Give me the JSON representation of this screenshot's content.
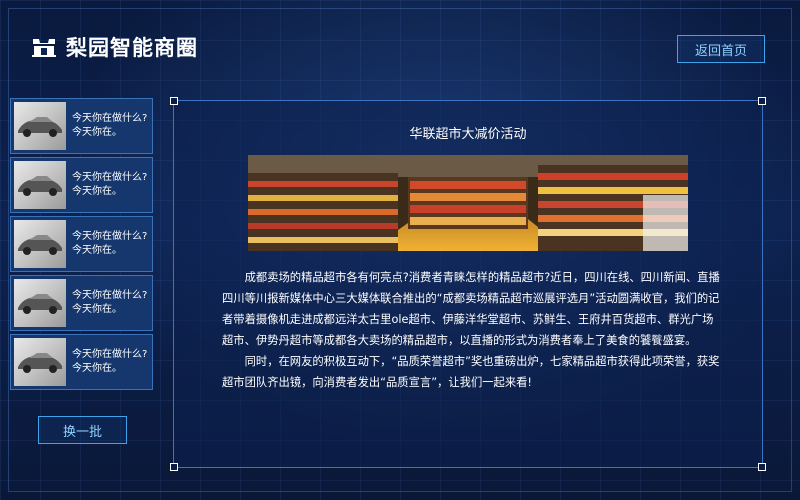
{
  "header": {
    "logo_text": "梨园智能商圈",
    "logo_icon": "storefront-logo-icon",
    "home_button_label": "返回首页"
  },
  "sidebar": {
    "items": [
      {
        "thumb_icon": "car-thumbnail",
        "line1": "今天你在做什么?",
        "line2": "今天你在。"
      },
      {
        "thumb_icon": "car-thumbnail",
        "line1": "今天你在做什么?",
        "line2": "今天你在。"
      },
      {
        "thumb_icon": "car-thumbnail",
        "line1": "今天你在做什么?",
        "line2": "今天你在。"
      },
      {
        "thumb_icon": "car-thumbnail",
        "line1": "今天你在做什么?",
        "line2": "今天你在。"
      },
      {
        "thumb_icon": "car-thumbnail",
        "line1": "今天你在做什么?",
        "line2": "今天你在。"
      }
    ],
    "refresh_button_label": "换一批"
  },
  "article": {
    "title": "华联超市大减价活动",
    "image_subject": "supermarket-shelves-photo",
    "paragraphs": [
      "成都卖场的精品超市各有何亮点?消费者青睐怎样的精品超市?近日，四川在线、四川新闻、直播四川等川报新媒体中心三大媒体联合推出的“成都卖场精品超市巡展评选月”活动圆满收官，我们的记者带着摄像机走进成都远洋太古里ole超市、伊藤洋华堂超市、苏鲜生、王府井百货超市、群光广场超市、伊势丹超市等成都各大卖场的精品超市，以直播的形式为消费者奉上了美食的饕餮盛宴。",
      "同时，在网友的积极互动下，“品质荣誉超市”奖也重磅出炉，七家精品超市获得此项荣誉，获奖超市团队齐出镜，向消费者发出“品质宣言”，让我们一起来看!"
    ]
  },
  "colors": {
    "background": "#0d2250",
    "accent_border": "#3ea3e8",
    "button_text": "#8fd0ff",
    "sidebar_item_bg": "#16376e"
  }
}
